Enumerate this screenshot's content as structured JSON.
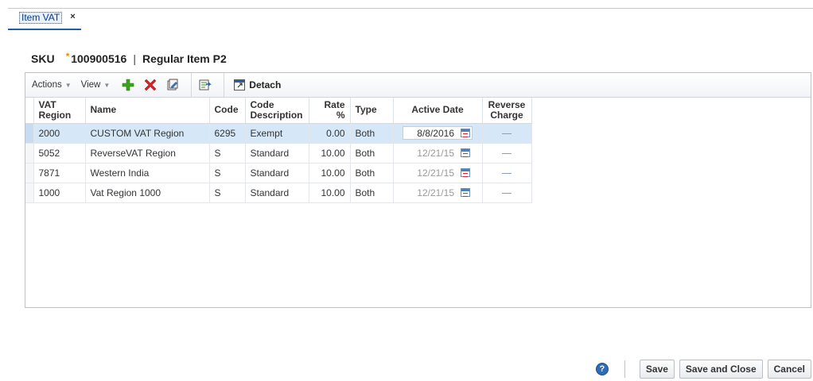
{
  "tab": {
    "label": "Item VAT",
    "close_glyph": "×"
  },
  "title": {
    "prefix": "SKU",
    "required_mark": "*",
    "sku": "100900516",
    "separator": "|",
    "item_desc": "Regular Item P2"
  },
  "toolbar": {
    "actions_label": "Actions",
    "view_label": "View",
    "icons": [
      "add-icon",
      "delete-icon",
      "edit-icon",
      "export-icon",
      "detach-icon"
    ],
    "detach_label": "Detach"
  },
  "table": {
    "columns": [
      "VAT Region",
      "Name",
      "Code",
      "Code Description",
      "Rate %",
      "Type",
      "Active Date",
      "Reverse Charge"
    ],
    "rows": [
      {
        "region": "2000",
        "name": "CUSTOM VAT Region",
        "code": "6295",
        "desc": "Exempt",
        "rate": "0.00",
        "type": "Both",
        "date": "8/8/2016",
        "reverse": ""
      },
      {
        "region": "5052",
        "name": "ReverseVAT Region",
        "code": "S",
        "desc": "Standard",
        "rate": "10.00",
        "type": "Both",
        "date": "12/21/15",
        "reverse": ""
      },
      {
        "region": "7871",
        "name": "Western India",
        "code": "S",
        "desc": "Standard",
        "rate": "10.00",
        "type": "Both",
        "date": "12/21/15",
        "reverse": ""
      },
      {
        "region": "1000",
        "name": "Vat Region 1000",
        "code": "S",
        "desc": "Standard",
        "rate": "10.00",
        "type": "Both",
        "date": "12/21/15",
        "reverse": ""
      }
    ]
  },
  "footer": {
    "help_glyph": "?",
    "save_label": "Save",
    "save_close_label": "Save and Close",
    "cancel_label": "Cancel"
  },
  "colors": {
    "accent": "#1d5fa8",
    "selected_row": "#d6e8f7",
    "required": "#e58f00"
  }
}
